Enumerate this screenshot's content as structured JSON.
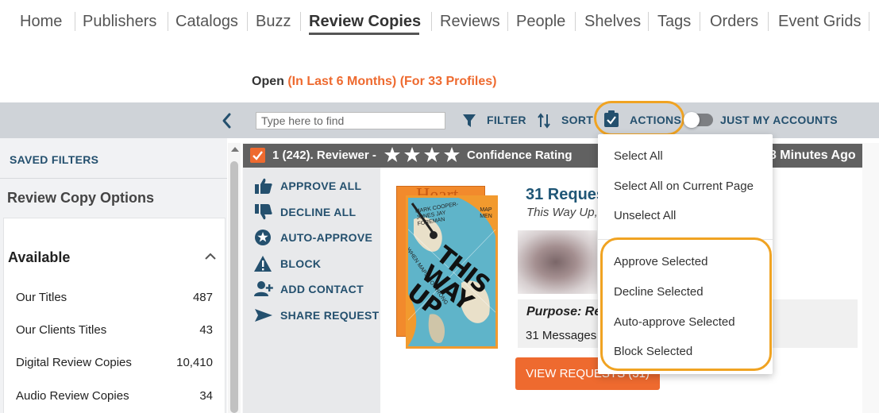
{
  "nav": {
    "items": [
      "Home",
      "Publishers",
      "Catalogs",
      "Buzz",
      "Review Copies",
      "Reviews",
      "People",
      "Shelves",
      "Tags",
      "Orders",
      "Event Grids"
    ],
    "active": "Review Copies"
  },
  "status": {
    "open": "Open",
    "timeframe": "(In Last 6 Months)",
    "profiles": "(For 33 Profiles)"
  },
  "toolbar": {
    "search_placeholder": "Type here to find",
    "filter": "FILTER",
    "sort": "SORT",
    "actions": "ACTIONS",
    "just_my_accounts": "JUST MY ACCOUNTS",
    "just_my_accounts_on": false
  },
  "sidebar": {
    "saved_filters": "SAVED FILTERS",
    "title": "Review Copy Options",
    "section": "Available",
    "filters": [
      {
        "label": "Our Titles",
        "count": "487"
      },
      {
        "label": "Our Clients Titles",
        "count": "43"
      },
      {
        "label": "Digital Review Copies",
        "count": "10,410"
      },
      {
        "label": "Audio Review Copies",
        "count": "34"
      }
    ]
  },
  "card": {
    "checked": true,
    "header": "1 (242). Reviewer -",
    "stars": 4,
    "confidence": "Confidence Rating",
    "time": "28 Minutes Ago",
    "actions": [
      {
        "label": "APPROVE ALL",
        "icon": "thumbs-up-icon"
      },
      {
        "label": "DECLINE ALL",
        "icon": "thumbs-down-icon"
      },
      {
        "label": "AUTO-APPROVE",
        "icon": "star-badge-icon"
      },
      {
        "label": "BLOCK",
        "icon": "warning-icon"
      },
      {
        "label": "ADD CONTACT",
        "icon": "add-user-icon"
      },
      {
        "label": "SHARE REQUEST",
        "icon": "share-arrow-icon"
      }
    ],
    "book_title": "THIS WAY UP",
    "book_back_title": "Heart",
    "book_authors": "MARK COOPER-JONES JAY FOREMAN",
    "book_subtitle": "WHEN MAPS GO WRONG",
    "book_subtitle2": "(and why it matters)",
    "book_map": "MAP MEN",
    "request_title": "31 Reques",
    "request_sub": "This Way Up,",
    "purpose": "Purpose: Re",
    "messages": "31 Messages",
    "view_button": "VIEW REQUESTS (31)"
  },
  "dropdown": {
    "items_top": [
      "Select All",
      "Select All on Current Page",
      "Unselect All"
    ],
    "items_bottom": [
      "Approve Selected",
      "Decline Selected",
      "Auto-approve Selected",
      "Block Selected"
    ]
  },
  "colors": {
    "accent": "#ee6a2f",
    "highlight": "#f0a322",
    "link_blue": "#24506e"
  }
}
